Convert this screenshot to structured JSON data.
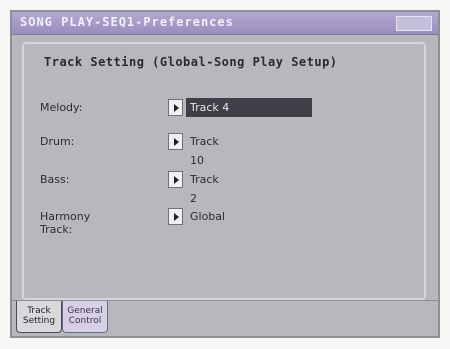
{
  "window": {
    "title": "SONG PLAY-SEQ1-Preferences"
  },
  "section": {
    "heading": "Track Setting (Global-Song Play Setup)"
  },
  "rows": [
    {
      "label": "Melody:",
      "value": "Track 4",
      "selected": true
    },
    {
      "label": "Drum:",
      "value": "Track 10",
      "selected": false
    },
    {
      "label": "Bass:",
      "value": "Track 2",
      "selected": false
    },
    {
      "label": "Harmony Track:",
      "value": "Global",
      "selected": false
    }
  ],
  "tabs": [
    {
      "line1": "Track",
      "line2": "Setting",
      "active": true
    },
    {
      "line1": "General",
      "line2": "Control",
      "active": false
    }
  ],
  "colors": {
    "titlebar": "#9a8fbd",
    "screen_bg": "#b7b8bd",
    "selected_value_bg": "#3e3f47"
  }
}
